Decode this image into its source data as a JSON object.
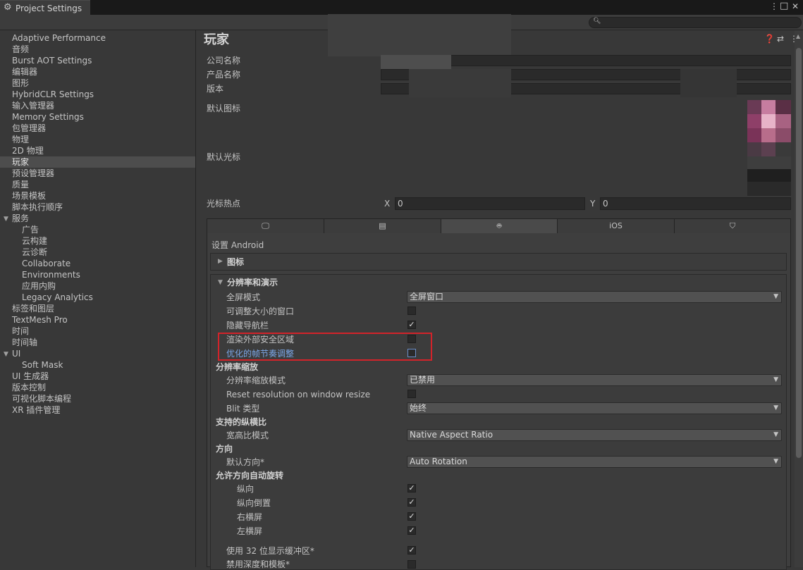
{
  "window": {
    "tab_title": "Project Settings",
    "search_placeholder": ""
  },
  "sidebar": {
    "items": [
      {
        "label": "Adaptive Performance"
      },
      {
        "label": "音频"
      },
      {
        "label": "Burst AOT Settings"
      },
      {
        "label": "编辑器"
      },
      {
        "label": "图形"
      },
      {
        "label": "HybridCLR Settings"
      },
      {
        "label": "输入管理器"
      },
      {
        "label": "Memory Settings"
      },
      {
        "label": "包管理器"
      },
      {
        "label": "物理"
      },
      {
        "label": "2D 物理"
      },
      {
        "label": "玩家"
      },
      {
        "label": "预设管理器"
      },
      {
        "label": "质量"
      },
      {
        "label": "场景模板"
      },
      {
        "label": "脚本执行顺序"
      },
      {
        "label": "服务"
      },
      {
        "label": "广告"
      },
      {
        "label": "云构建"
      },
      {
        "label": "云诊断"
      },
      {
        "label": "Collaborate"
      },
      {
        "label": "Environments"
      },
      {
        "label": "应用内购"
      },
      {
        "label": "Legacy Analytics"
      },
      {
        "label": "标签和图层"
      },
      {
        "label": "TextMesh Pro"
      },
      {
        "label": "时间"
      },
      {
        "label": "时间轴"
      },
      {
        "label": "UI"
      },
      {
        "label": "Soft Mask"
      },
      {
        "label": "UI 生成器"
      },
      {
        "label": "版本控制"
      },
      {
        "label": "可视化脚本编程"
      },
      {
        "label": "XR 插件管理"
      }
    ],
    "selected": "玩家"
  },
  "main": {
    "title": "玩家",
    "company_label": "公司名称",
    "product_label": "产品名称",
    "version_label": "版本",
    "default_icon_label": "默认图标",
    "default_cursor_label": "默认光标",
    "hotspot_label": "光标热点",
    "hotspot_x_label": "X",
    "hotspot_x_value": "0",
    "hotspot_y_label": "Y",
    "hotspot_y_value": "0",
    "platform_tabs": [
      {
        "name": "standalone",
        "label": "",
        "icon": "monitor-icon"
      },
      {
        "name": "server",
        "label": "",
        "icon": "server-icon"
      },
      {
        "name": "android",
        "label": "",
        "icon": "android-icon",
        "selected": true
      },
      {
        "name": "ios",
        "label": "iOS",
        "icon": ""
      },
      {
        "name": "webgl",
        "label": "",
        "icon": "html5-icon"
      }
    ],
    "settings_for": "设置 Android",
    "icon_section": "图标",
    "resolution_section": "分辨率和演示",
    "fullscreen_mode_label": "全屏模式",
    "fullscreen_mode_value": "全屏窗口",
    "resizable_window_label": "可调整大小的窗口",
    "hide_nav_bar_label": "隐藏导航栏",
    "render_outside_safe_label": "渲染外部安全区域",
    "optimized_frame_pacing_label": "优化的帧节奏调整",
    "resolution_scaling_header": "分辨率缩放",
    "resolution_scaling_mode_label": "分辨率缩放模式",
    "resolution_scaling_mode_value": "已禁用",
    "reset_resolution_label": "Reset resolution on window resize",
    "blit_type_label": "Blit 类型",
    "blit_type_value": "始终",
    "aspect_header": "支持的纵横比",
    "aspect_mode_label": "宽高比模式",
    "aspect_mode_value": "Native Aspect Ratio",
    "orientation_header": "方向",
    "default_orientation_label": "默认方向*",
    "default_orientation_value": "Auto Rotation",
    "autorotate_header": "允许方向自动旋转",
    "portrait_label": "纵向",
    "portrait_upside_label": "纵向倒置",
    "landscape_right_label": "右横屏",
    "landscape_left_label": "左横屏",
    "use32bit_label": "使用 32 位显示缓冲区*",
    "disable_depth_label": "禁用深度和模板*"
  },
  "checkboxes": {
    "resizable_window": false,
    "hide_nav_bar": true,
    "render_outside_safe": false,
    "optimized_frame_pacing": false,
    "reset_resolution": false,
    "portrait": true,
    "portrait_upside": true,
    "landscape_right": true,
    "landscape_left": true,
    "use32bit": true,
    "disable_depth": false
  },
  "colors": {
    "highlight_box": "#d2232a",
    "focused_label": "#7ba7e8"
  }
}
